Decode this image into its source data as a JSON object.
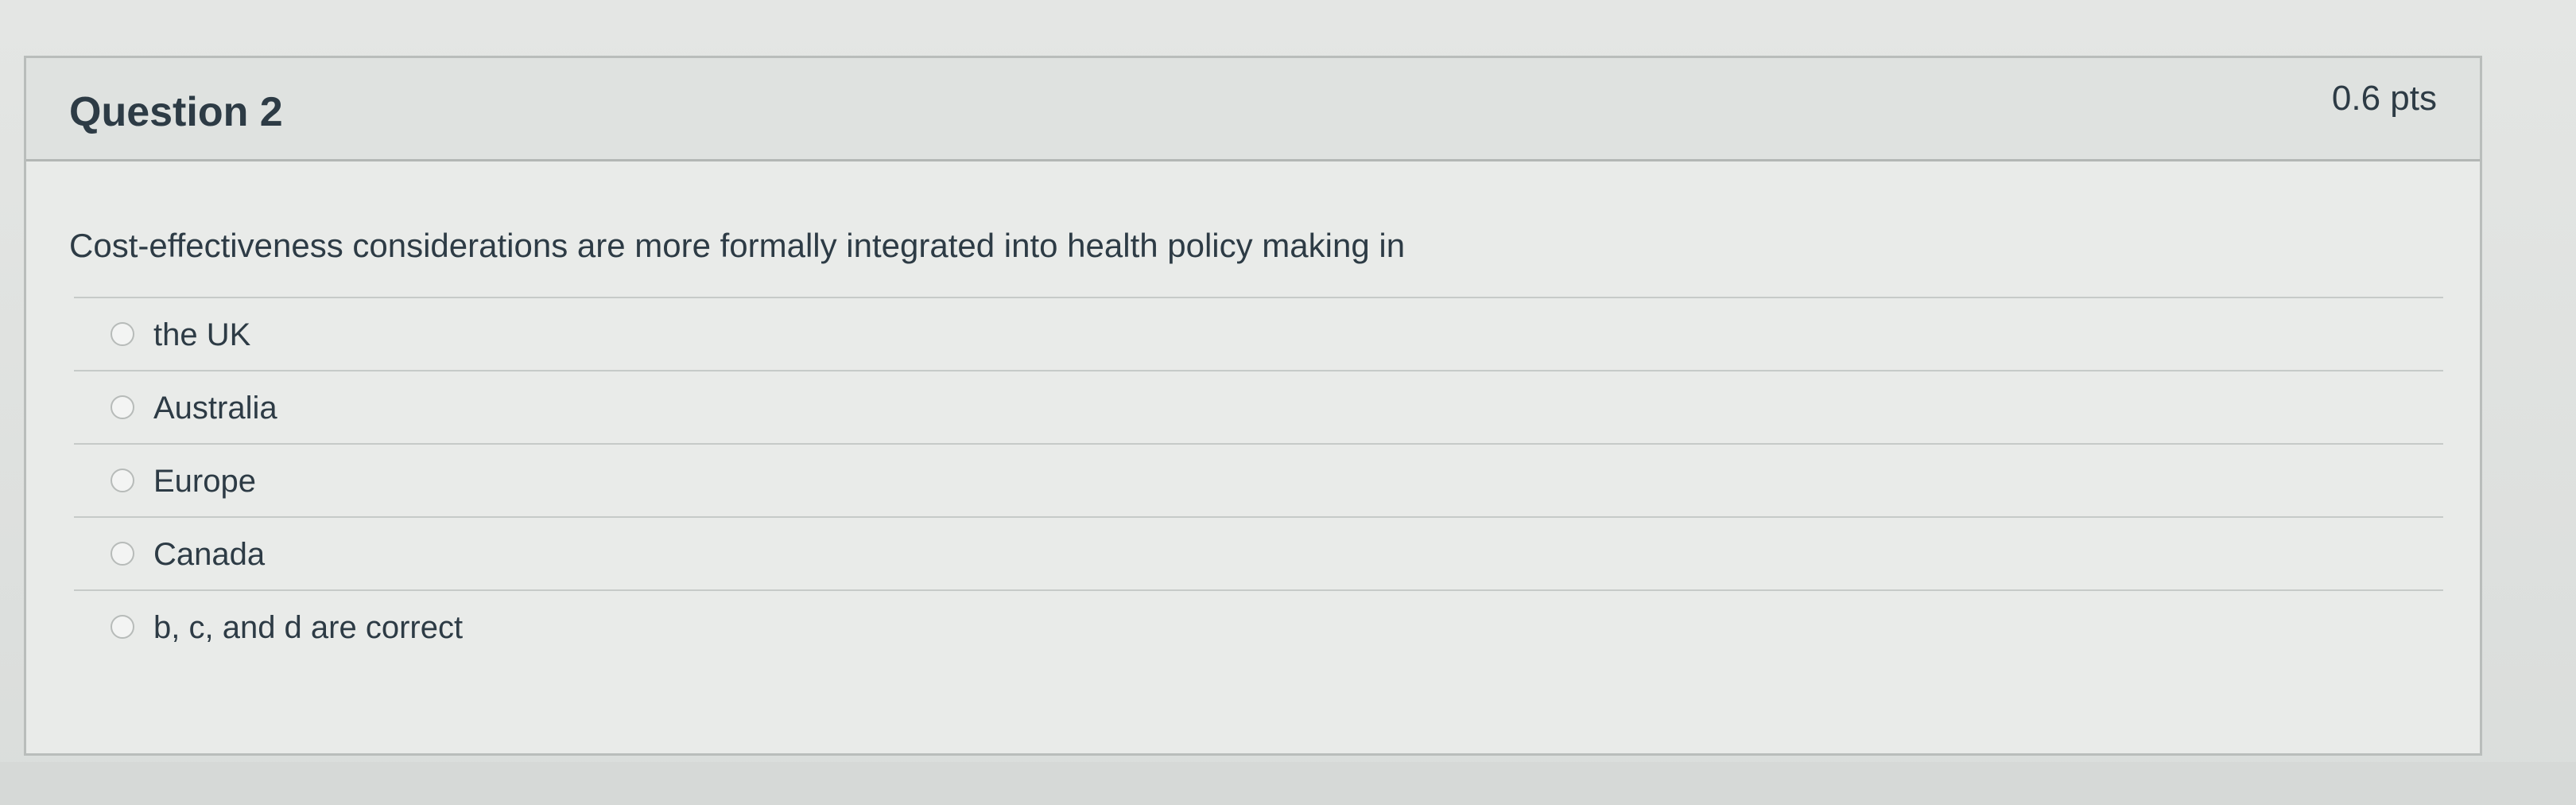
{
  "question": {
    "title": "Question 2",
    "points": "0.6 pts",
    "text": "Cost-effectiveness considerations are more formally integrated into health policy making in"
  },
  "answers": [
    {
      "label": "the UK"
    },
    {
      "label": "Australia"
    },
    {
      "label": "Europe"
    },
    {
      "label": "Canada"
    },
    {
      "label": "b, c, and d are correct"
    }
  ],
  "colors": {
    "text": "#2d3b45",
    "header_bg": "#dfe2e0",
    "card_bg": "#e9ebe9",
    "border": "#b9bdbb"
  }
}
